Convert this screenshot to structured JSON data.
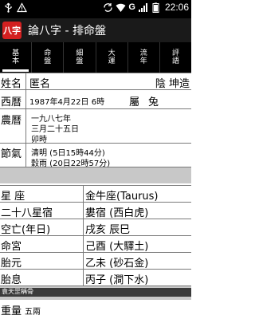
{
  "statusbar": {
    "network": "G",
    "time": "22:06"
  },
  "app": {
    "logo_text": "八字",
    "title": "論八字 - 排命盤"
  },
  "tabs": [
    {
      "line1": "基",
      "line2": "本",
      "active": true
    },
    {
      "line1": "命",
      "line2": "盤",
      "active": false
    },
    {
      "line1": "細",
      "line2": "盤",
      "active": false
    },
    {
      "line1": "大",
      "line2": "運",
      "active": false
    },
    {
      "line1": "流",
      "line2": "年",
      "active": false
    },
    {
      "line1": "評",
      "line2": "語",
      "active": false
    }
  ],
  "basic": {
    "name_label": "姓名",
    "name_value": "匿名",
    "gender_label": "陰 坤造",
    "solar_label": "西曆",
    "solar_value": "1987年4月22日 6時",
    "zodiac_label": "屬",
    "zodiac_value": "兔",
    "lunar_label": "農曆",
    "lunar_lines": [
      "一九八七年",
      "三月二十五日",
      "卯時"
    ],
    "term_label": "節氣",
    "term_lines": [
      "清明 (5日15時44分)",
      "穀雨 (20日22時57分)"
    ]
  },
  "info": {
    "rows": [
      {
        "label": "星 座",
        "value": "金牛座(Taurus)"
      },
      {
        "label": "二十八星宿",
        "value": "婁宿 (西白虎)"
      },
      {
        "label": "空亡(年日)",
        "value": "戌亥 辰巳"
      },
      {
        "label": "命宮",
        "value": "己酉 (大驛土)"
      },
      {
        "label": "胎元",
        "value": "乙未 (砂石金)"
      },
      {
        "label": "胎息",
        "value": "丙子 (澗下水)"
      }
    ]
  },
  "footer": {
    "strip_text": "袁天罡稱骨",
    "weight_label": "重量",
    "weight_value": "五兩"
  },
  "colors": {
    "accent": "#d32020",
    "band": "#c8c8c8",
    "divider": "#7a7a7a"
  }
}
